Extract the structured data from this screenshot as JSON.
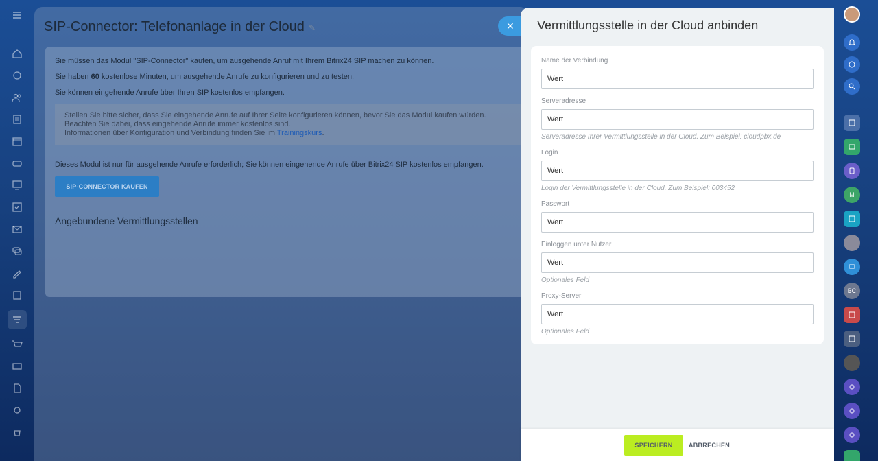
{
  "background": {
    "title": "SIP-Connector: Telefonanlage in der Cloud",
    "line1": "Sie müssen das Modul \"SIP-Connector\" kaufen, um ausgehende Anruf mit Ihrem Bitrix24 SIP machen zu können.",
    "line2_prefix": "Sie haben ",
    "line2_bold": "60",
    "line2_suffix": " kostenlose Minuten, um ausgehende Anrufe zu konfigurieren und zu testen.",
    "line3": "Sie können eingehende Anrufe über Ihren SIP kostenlos empfangen.",
    "note_line1": "Stellen Sie bitte sicher, dass Sie eingehende Anrufe auf Ihrer Seite konfigurieren können, bevor Sie das Modul kaufen würden.",
    "note_line2": "Beachten Sie dabei, dass eingehende Anrufe immer kostenlos sind.",
    "note_line3_prefix": "Informationen über Konfiguration und Verbindung finden Sie im ",
    "note_link": "Trainingskurs",
    "note_line3_suffix": ".",
    "line4": "Dieses Modul ist nur für ausgehende Anrufe erforderlich; Sie können eingehende Anrufe über Bitrix24 SIP kostenlos empfangen.",
    "buy_button": "SIP-CONNECTOR KAUFEN",
    "subtitle": "Angebundene Vermittlungsstellen"
  },
  "slider": {
    "title": "Vermittlungsstelle in der Cloud anbinden",
    "fields": [
      {
        "label": "Name der Verbindung",
        "value": "Wert",
        "hint": ""
      },
      {
        "label": "Serveradresse",
        "value": "Wert",
        "hint": "Serveradresse Ihrer Vermittlungsstelle in der Cloud. Zum Beispiel: cloudpbx.de"
      },
      {
        "label": "Login",
        "value": "Wert",
        "hint": "Login der Vermittlungsstelle in der Cloud. Zum Beispiel: 003452"
      },
      {
        "label": "Passwort",
        "value": "Wert",
        "hint": ""
      },
      {
        "label": "Einloggen unter Nutzer",
        "value": "Wert",
        "hint": "Optionales Feld"
      },
      {
        "label": "Proxy-Server",
        "value": "Wert",
        "hint": "Optionales Feld"
      }
    ],
    "save_label": "SPEICHERN",
    "cancel_label": "ABBRECHEN"
  },
  "right_bar": {
    "initials_m": "M",
    "initials_bc": "BC"
  },
  "colors": {
    "save": "#bbed21",
    "accent": "#3b9be0"
  }
}
